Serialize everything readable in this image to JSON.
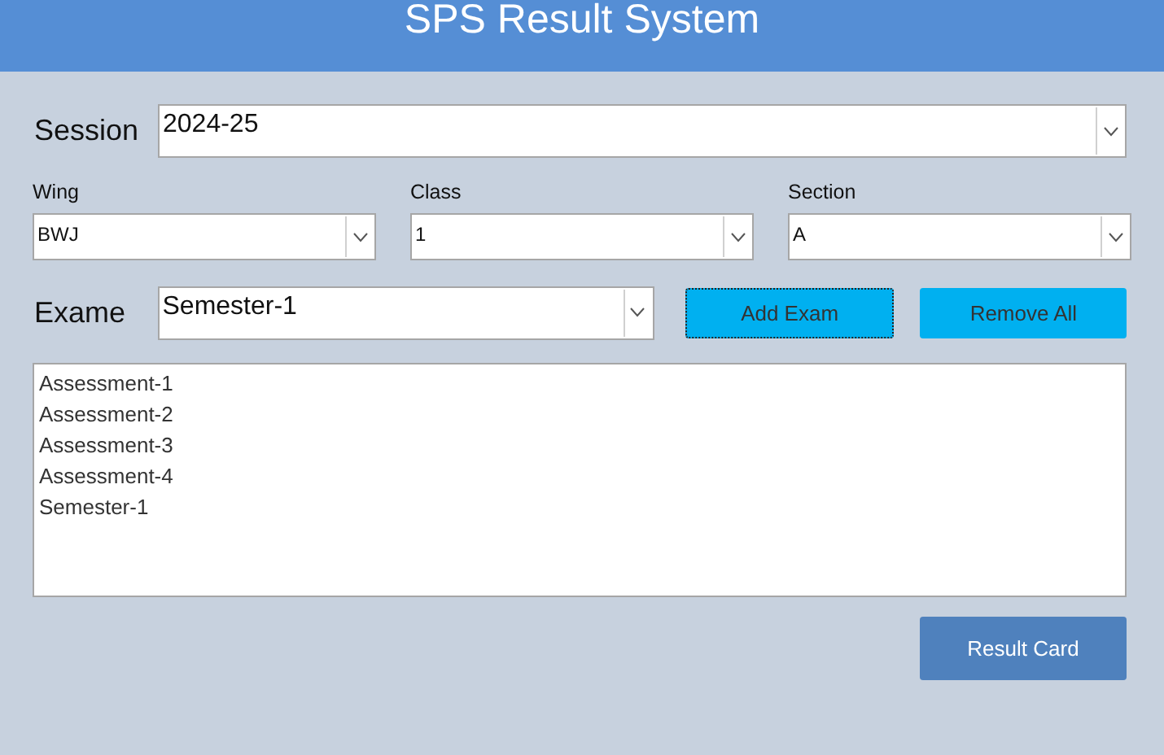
{
  "header": {
    "title": "SPS Result System"
  },
  "session": {
    "label": "Session",
    "value": "2024-25"
  },
  "filters": [
    {
      "label": "Wing",
      "value": "BWJ"
    },
    {
      "label": "Class",
      "value": "1"
    },
    {
      "label": "Section",
      "value": "A"
    }
  ],
  "exam": {
    "label": "Exame",
    "value": "Semester-1"
  },
  "exam_buttons": [
    {
      "label": "Add Exam",
      "focused": true
    },
    {
      "label": "Remove All",
      "focused": false
    }
  ],
  "exam_list": [
    "Assessment-1",
    "Assessment-2",
    "Assessment-3",
    "Assessment-4",
    "Semester-1"
  ],
  "result_button": {
    "label": "Result Card"
  }
}
